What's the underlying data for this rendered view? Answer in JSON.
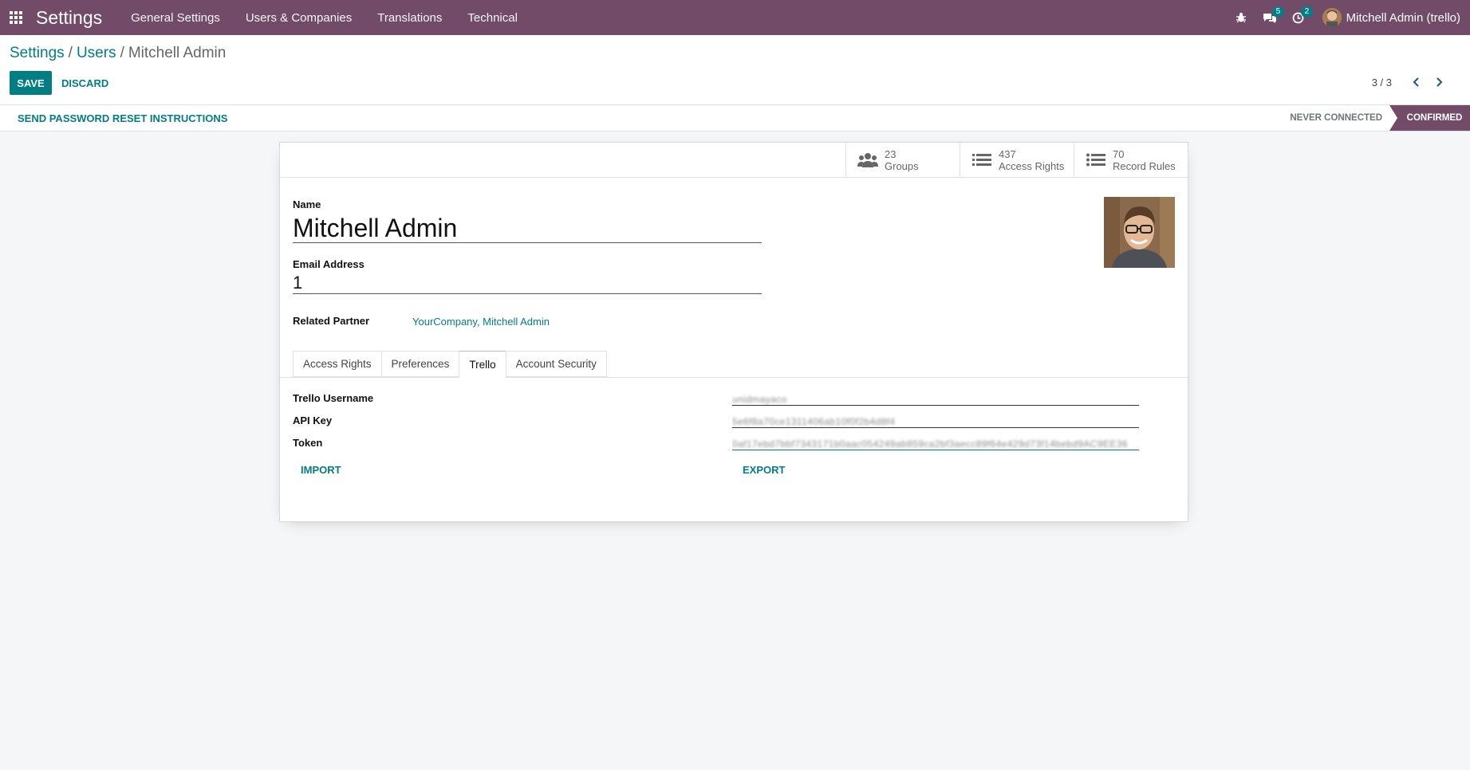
{
  "navbar": {
    "app_title": "Settings",
    "menu": [
      "General Settings",
      "Users & Companies",
      "Translations",
      "Technical"
    ],
    "messages_count": "5",
    "activities_count": "2",
    "user_name": "Mitchell Admin (trello)"
  },
  "breadcrumb": {
    "items": [
      "Settings",
      "Users"
    ],
    "current": "Mitchell Admin"
  },
  "actions": {
    "save": "SAVE",
    "discard": "DISCARD"
  },
  "pager": {
    "value": "3 / 3"
  },
  "statusbar": {
    "reset_button": "SEND PASSWORD RESET INSTRUCTIONS",
    "stage_never": "NEVER CONNECTED",
    "stage_confirmed": "CONFIRMED"
  },
  "stats": [
    {
      "count": "23",
      "label": "Groups"
    },
    {
      "count": "437",
      "label": "Access Rights"
    },
    {
      "count": "70",
      "label": "Record Rules"
    }
  ],
  "form": {
    "name_label": "Name",
    "name_value": "Mitchell Admin",
    "email_label": "Email Address",
    "email_value": "1",
    "partner_label": "Related Partner",
    "partner_value": "YourCompany, Mitchell Admin"
  },
  "tabs": [
    "Access Rights",
    "Preferences",
    "Trello",
    "Account Security"
  ],
  "trello": {
    "username_label": "Trello Username",
    "username_value": "unidmayaco",
    "api_key_label": "API Key",
    "api_key_value": "5e6f8a70ce1311406ab10f0f2b4d8f4",
    "token_label": "Token",
    "token_value": "0af17ebd7bbf7343171b0aac054249ab859ca2bf3aecc89f64e429d73f14bebd9AC9EE36",
    "import_button": "IMPORT",
    "export_button": "EXPORT"
  },
  "colors": {
    "brand": "#714b67",
    "accent": "#017e84"
  }
}
